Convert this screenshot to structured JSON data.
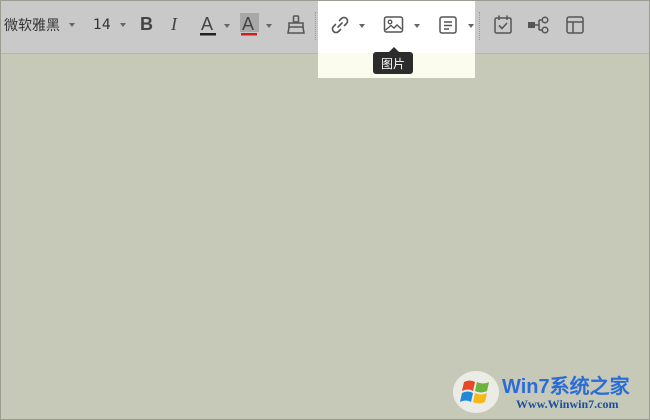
{
  "toolbar": {
    "font_family": "微软雅黑",
    "font_size": "14",
    "bold_label": "B",
    "italic_label": "I",
    "font_color_glyph": "A",
    "highlight_glyph": "A",
    "font_color_underline": "#222222",
    "highlight_underline": "#cc2222"
  },
  "tooltip": {
    "text": "图片"
  },
  "watermark": {
    "title": "Win7系统之家",
    "url": "Www.Winwin7.com"
  },
  "colors": {
    "toolbar_bg": "#c9c9c9",
    "editor_bg": "#c6c8b8",
    "watermark_blue": "#2a6dd6"
  }
}
